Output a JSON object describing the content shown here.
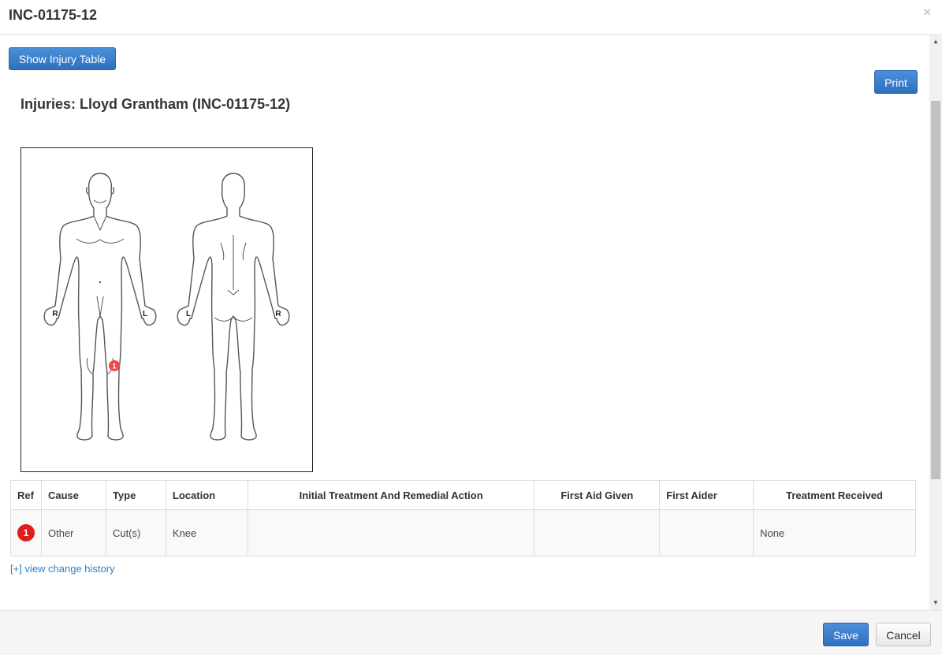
{
  "modal": {
    "title": "INC-01175-12",
    "close_symbol": "×"
  },
  "toolbar": {
    "show_injury_table_label": "Show Injury Table",
    "print_label": "Print"
  },
  "injuries_heading": "Injuries: Lloyd Grantham (INC-01175-12)",
  "diagram": {
    "front_left_hand_label": "R",
    "front_right_hand_label": "L",
    "back_left_hand_label": "L",
    "back_right_hand_label": "R",
    "marker_label": "1",
    "marker_color": "#f04a4a"
  },
  "table": {
    "headers": {
      "ref": "Ref",
      "cause": "Cause",
      "type": "Type",
      "location": "Location",
      "initial_treatment": "Initial Treatment And Remedial Action",
      "first_aid_given": "First Aid Given",
      "first_aider": "First Aider",
      "treatment_received": "Treatment Received"
    },
    "rows": [
      {
        "ref": "1",
        "cause": "Other",
        "type": "Cut(s)",
        "location": "Knee",
        "initial_treatment": "",
        "first_aid_given": "",
        "first_aider": "",
        "treatment_received": "None"
      }
    ]
  },
  "history_link": "[+] view change history",
  "footer": {
    "save_label": "Save",
    "cancel_label": "Cancel"
  },
  "colors": {
    "primary": "#2f6fc0",
    "link": "#2a82c9",
    "badge": "#e21b1b"
  }
}
